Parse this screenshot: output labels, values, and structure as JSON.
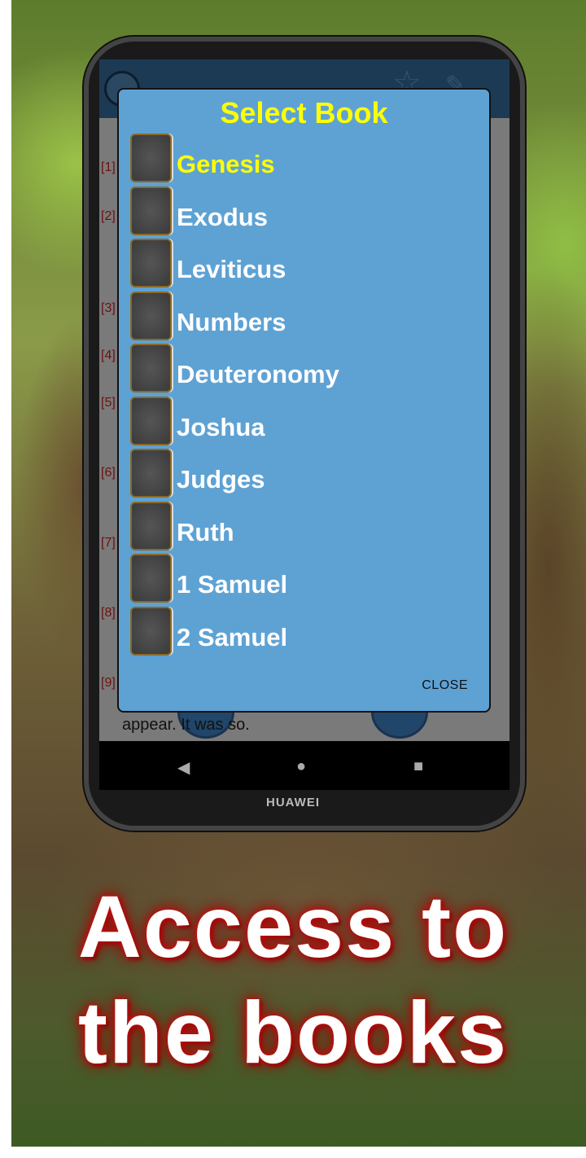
{
  "dialog": {
    "title": "Select Book",
    "close_label": "CLOSE",
    "books": [
      {
        "label": "Genesis",
        "selected": true
      },
      {
        "label": "Exodus"
      },
      {
        "label": "Leviticus"
      },
      {
        "label": "Numbers"
      },
      {
        "label": "Deuteronomy"
      },
      {
        "label": "Joshua"
      },
      {
        "label": "Judges"
      },
      {
        "label": "Ruth"
      },
      {
        "label": "1 Samuel"
      },
      {
        "label": "2 Samuel"
      }
    ]
  },
  "background_text": {
    "verses": [
      "[1]",
      "[2]",
      "[3]",
      "[4]",
      "[5]",
      "[6]",
      "[7]",
      "[8]",
      "[9]"
    ],
    "last_line": "appear. It was so."
  },
  "device": {
    "brand": "HUAWEI"
  },
  "promo": {
    "line1": "Access to",
    "line2": "the books"
  },
  "colors": {
    "dialog_bg": "#5ea2d4",
    "selected": "#ffff00",
    "toolbar": "#1d3a55"
  }
}
